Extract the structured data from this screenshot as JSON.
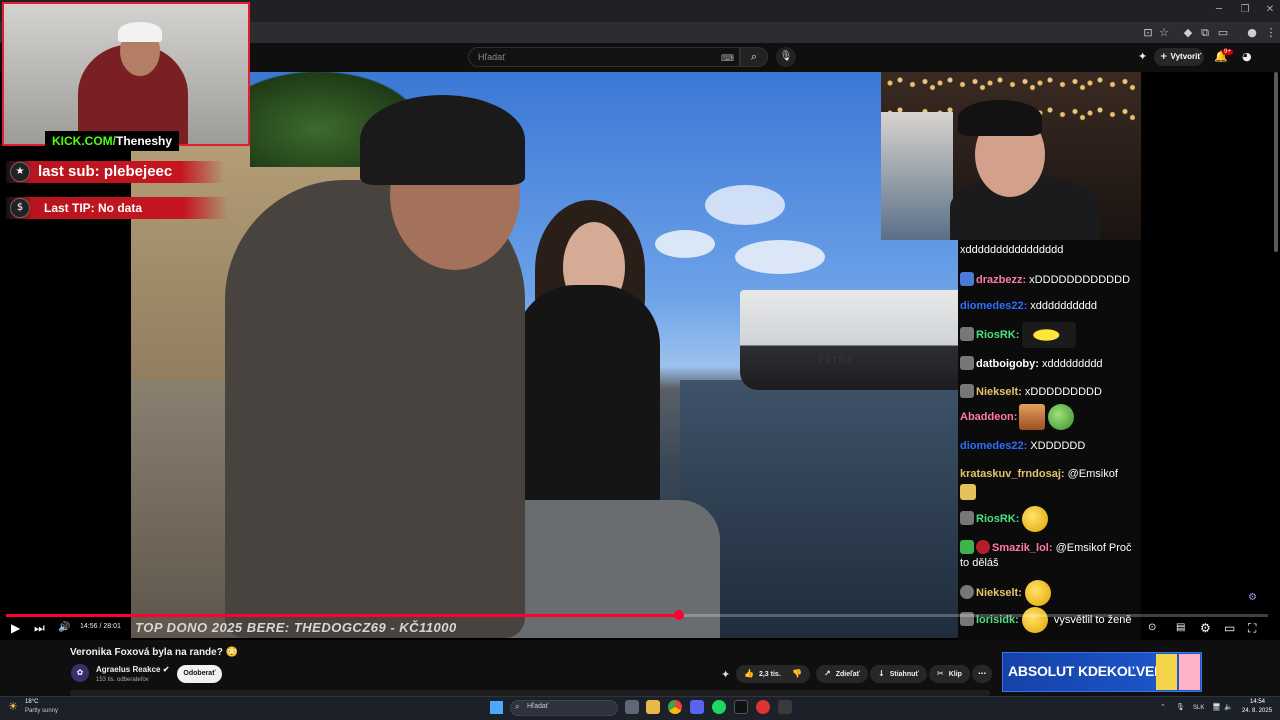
{
  "browser": {
    "window_controls": [
      "─",
      "❐",
      "✕"
    ]
  },
  "header": {
    "search_placeholder": "Hľadať",
    "create_label": "Vytvoriť",
    "notification_count": "9+"
  },
  "overlay": {
    "kick_prefix": "KICK.COM/",
    "kick_user": "Theneshy",
    "last_sub": "last sub: plebejeec",
    "last_tip": "Last TIP: No data",
    "boat_name": "PETRA",
    "donor_banner": "TOP DONO 2025 BERE: THEDOGCZ69 - KČ11000"
  },
  "chat": {
    "messages": [
      {
        "user": "",
        "text": "xdddddddddddddddd",
        "color": "#ffffff"
      },
      {
        "user": "drazbezz:",
        "text": " xDDDDDDDDDDDD",
        "color": "#ff7aa8"
      },
      {
        "user": "diomedes22:",
        "text": " xdddddddddd",
        "color": "#2f6dff"
      },
      {
        "user": "RiosRK:",
        "text": "",
        "color": "#4ce07d"
      },
      {
        "user": "datboigoby:",
        "text": " xddddddddd",
        "color": "#ffffff"
      },
      {
        "user": "Niekselt:",
        "text": " xDDDDDDDDD",
        "color": "#e5c46b"
      },
      {
        "user": "Abaddeon:",
        "text": "",
        "color": "#ff7aa8"
      },
      {
        "user": "diomedes22:",
        "text": " XDDDDDD",
        "color": "#2f6dff"
      },
      {
        "user": "krataskuv_frndosaj:",
        "text": " @Emsikof",
        "color": "#e5c46b"
      },
      {
        "user": "RiosRK:",
        "text": "",
        "color": "#4ce07d"
      },
      {
        "user": "Smazik_lol:",
        "text": " @Emsikof Proč",
        "color": "#ff7aa8"
      },
      {
        "user": "",
        "text": "to děláš",
        "color": "#ffffff"
      },
      {
        "user": "Niekselt:",
        "text": "",
        "color": "#e5c46b"
      },
      {
        "user": "lorisidk:",
        "text": " vysvětlil to ženě",
        "color": "#4ce07d"
      }
    ]
  },
  "player": {
    "time": "14:56 / 28:01",
    "progress_fraction": 0.533,
    "play_icon": "▶",
    "next_icon": "⏭",
    "volume_icon": "🔊"
  },
  "video": {
    "title": "Veronika Foxová byla na rande? 😳",
    "channel": "Agraelus Reakce ✔",
    "subscribers": "153 tis. odberateľov",
    "subscribe_label": "Odoberať",
    "like_count": "2,3 tis.",
    "share_label": "Zdieľať",
    "download_label": "Stiahnuť",
    "clip_label": "Klip"
  },
  "ad": {
    "text": "ABSOLUT KDEKOĽVEK"
  },
  "taskbar": {
    "temp": "18°C",
    "weather": "Partly sunny",
    "search_placeholder": "Hľadať",
    "lang": "SLK",
    "time": "14:54",
    "date": "24. 8. 2025"
  },
  "colors": {
    "accent_red": "#ff0033",
    "kick_green": "#53fc18",
    "overlay_red": "#c7151f"
  }
}
